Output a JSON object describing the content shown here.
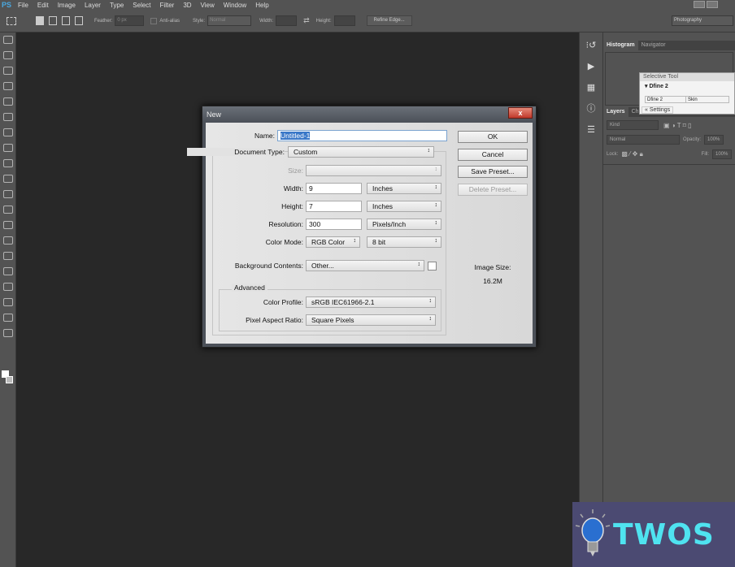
{
  "app": {
    "logo": "PS",
    "menu": [
      "File",
      "Edit",
      "Image",
      "Layer",
      "Type",
      "Select",
      "Filter",
      "3D",
      "View",
      "Window",
      "Help"
    ]
  },
  "options": {
    "feather_label": "Feather:",
    "feather_value": "0 px",
    "antialias": "Anti-alias",
    "style_label": "Style:",
    "style_value": "Normal",
    "width_label": "Width:",
    "height_label": "Height:",
    "refine_edge": "Refine Edge...",
    "workspace": "Photography"
  },
  "panels": {
    "tabs_top": [
      "Histogram",
      "Navigator"
    ],
    "tabs_layers": [
      "Layers",
      "Ch"
    ],
    "kind": "Kind",
    "blend": "Normal",
    "opacity_label": "Opacity:",
    "opacity_value": "100%",
    "lock_label": "Lock:",
    "fill_label": "Fill:",
    "fill_value": "100%"
  },
  "selective_tool": {
    "title": "Selective Tool",
    "item": "Dfine 2",
    "col1": "Dfine 2",
    "col2": "Skin",
    "settings": "Settings"
  },
  "dialog": {
    "title": "New",
    "close": "x",
    "name_label": "Name:",
    "name_value": "Untitled-1",
    "doctype_label": "Document Type:",
    "doctype_value": "Custom",
    "size_label": "Size:",
    "width_label": "Width:",
    "width_value": "9",
    "width_unit": "Inches",
    "height_label": "Height:",
    "height_value": "7",
    "height_unit": "Inches",
    "resolution_label": "Resolution:",
    "resolution_value": "300",
    "resolution_unit": "Pixels/Inch",
    "colormode_label": "Color Mode:",
    "colormode_value": "RGB Color",
    "bitdepth": "8 bit",
    "bg_label": "Background Contents:",
    "bg_value": "Other...",
    "advanced": "Advanced",
    "profile_label": "Color Profile:",
    "profile_value": "sRGB IEC61966-2.1",
    "par_label": "Pixel Aspect Ratio:",
    "par_value": "Square Pixels",
    "ok": "OK",
    "cancel": "Cancel",
    "save_preset": "Save Preset...",
    "delete_preset": "Delete Preset...",
    "image_size_label": "Image Size:",
    "image_size_value": "16.2M"
  },
  "watermark": {
    "text": "TWOS",
    "color": "#4fe3f0"
  }
}
